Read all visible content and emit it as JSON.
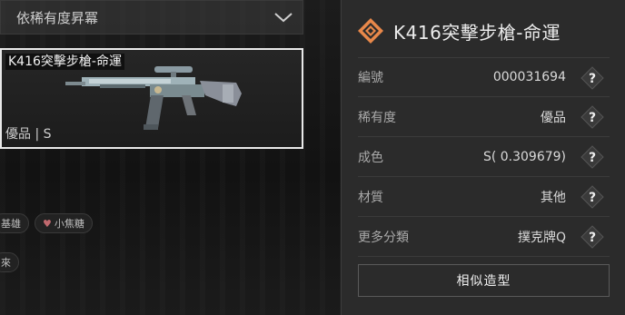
{
  "sort": {
    "label": "依稀有度昇冪"
  },
  "item": {
    "name": "K416突擊步槍-命運",
    "quality": "優品 | S"
  },
  "tags": {
    "partial": "基雄",
    "favorite": "小焦糖",
    "more": "來"
  },
  "detail": {
    "title": "K416突擊步槍-命運",
    "rows": [
      {
        "label": "編號",
        "value": "000031694"
      },
      {
        "label": "稀有度",
        "value": "優品"
      },
      {
        "label": "成色",
        "value": "S( 0.309679)"
      },
      {
        "label": "材質",
        "value": "其他"
      },
      {
        "label": "更多分類",
        "value": "撲克牌Q"
      }
    ],
    "similar_button": "相似造型"
  },
  "colors": {
    "accent": "#e8884a",
    "card_border": "#e9e9e9"
  }
}
